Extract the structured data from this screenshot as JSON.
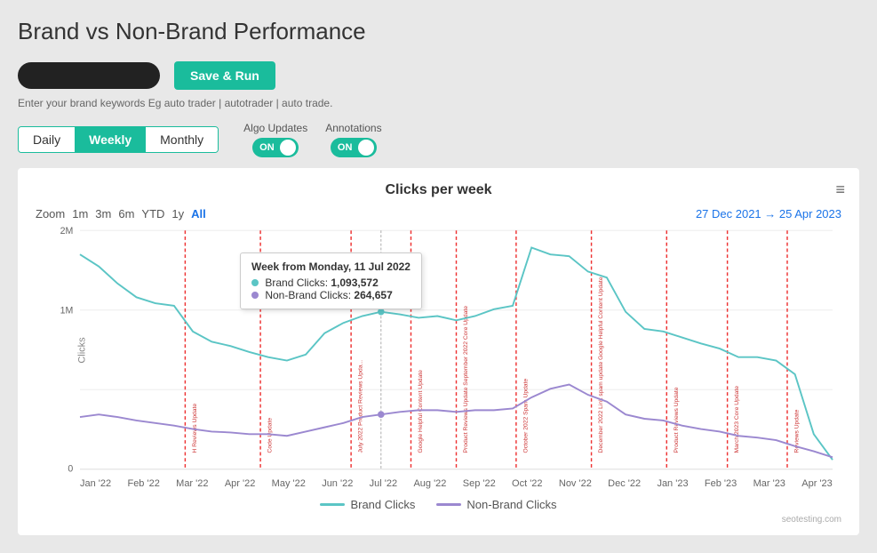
{
  "page": {
    "title": "Brand vs Non-Brand Performance"
  },
  "topbar": {
    "save_run_label": "Save & Run",
    "hint_text": "Enter your brand keywords Eg auto trader | autotrader | auto trade."
  },
  "tabs": {
    "items": [
      {
        "label": "Daily",
        "active": false
      },
      {
        "label": "Weekly",
        "active": true
      },
      {
        "label": "Monthly",
        "active": false
      }
    ]
  },
  "toggles": [
    {
      "label": "Algo Updates",
      "state": "ON"
    },
    {
      "label": "Annotations",
      "state": "ON"
    }
  ],
  "chart": {
    "title": "Clicks per week",
    "zoom_label": "Zoom",
    "zoom_options": [
      "1m",
      "3m",
      "6m",
      "YTD",
      "1y",
      "All"
    ],
    "active_zoom": "All",
    "date_range": "27 Dec 2021  →  25 Apr 2023",
    "y_labels": [
      "2M",
      "1M",
      "0"
    ],
    "y_axis_title": "Clicks",
    "x_labels": [
      "Jan '22",
      "Feb '22",
      "Mar '22",
      "Apr '22",
      "May '22",
      "Jun '22",
      "Jul '22",
      "Aug '22",
      "Sep '22",
      "Oct '22",
      "Nov '22",
      "Dec '22",
      "Jan '23",
      "Feb '23",
      "Mar '23",
      "Apr '23"
    ],
    "tooltip": {
      "title": "Week from Monday, 11 Jul 2022",
      "brand_label": "Brand Clicks:",
      "brand_value": "1,093,572",
      "nonbrand_label": "Non-Brand Clicks:",
      "nonbrand_value": "264,657"
    },
    "legend": {
      "brand_label": "Brand Clicks",
      "brand_color": "#5bc5c5",
      "nonbrand_label": "Non-Brand Clicks",
      "nonbrand_color": "#9b88d0"
    },
    "annotations": [
      {
        "label": "H Reviews Update",
        "x_pct": 14
      },
      {
        "label": "Code Update",
        "x_pct": 24
      },
      {
        "label": "July 2022 Product Reviews Upda...",
        "x_pct": 36
      },
      {
        "label": "Google Helpful Content Update",
        "x_pct": 44
      },
      {
        "label": "Product Reviews Update September 2022 Core Update",
        "x_pct": 50
      },
      {
        "label": "October 2022 Spam Update",
        "x_pct": 58
      },
      {
        "label": "December 2022 Link spam update Google Helpful Content Update",
        "x_pct": 68
      },
      {
        "label": "Product Reviews Update",
        "x_pct": 78
      },
      {
        "label": "March 2023 Core Update",
        "x_pct": 86
      },
      {
        "label": "Reviews Update",
        "x_pct": 94
      }
    ],
    "watermark": "seotesting.com"
  }
}
